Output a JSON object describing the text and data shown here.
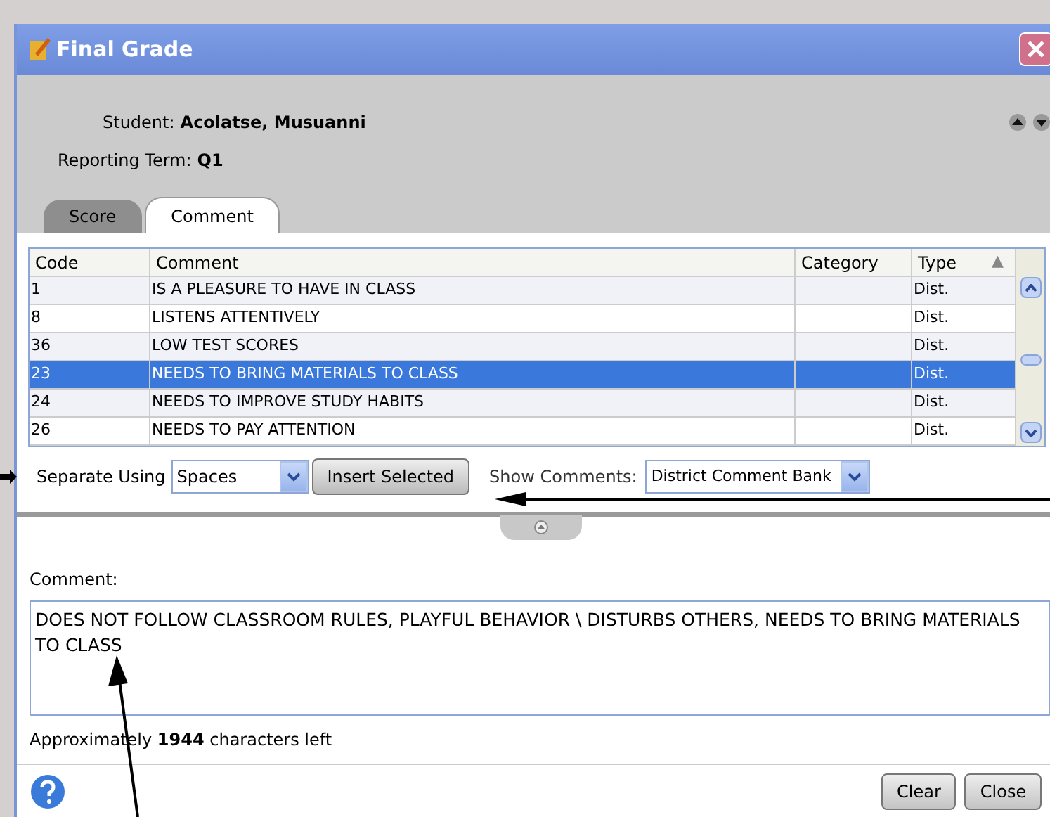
{
  "window": {
    "title": "Final Grade"
  },
  "student": {
    "label": "Student:",
    "value": "Acolatse, Musuanni"
  },
  "term": {
    "label": "Reporting Term:",
    "value": "Q1"
  },
  "tabs": [
    {
      "label": "Score",
      "selected": false
    },
    {
      "label": "Comment",
      "selected": true
    }
  ],
  "table": {
    "columns": [
      "Code",
      "Comment",
      "Category",
      "Type"
    ],
    "sort_mark": "▲",
    "rows": [
      {
        "code": "1",
        "comment": "IS A PLEASURE TO HAVE IN CLASS",
        "category": "",
        "type": "Dist.",
        "selected": false
      },
      {
        "code": "8",
        "comment": "LISTENS ATTENTIVELY",
        "category": "",
        "type": "Dist.",
        "selected": false
      },
      {
        "code": "36",
        "comment": "LOW TEST SCORES",
        "category": "",
        "type": "Dist.",
        "selected": false
      },
      {
        "code": "23",
        "comment": "NEEDS TO BRING MATERIALS TO CLASS",
        "category": "",
        "type": "Dist.",
        "selected": true
      },
      {
        "code": "24",
        "comment": "NEEDS TO IMPROVE STUDY HABITS",
        "category": "",
        "type": "Dist.",
        "selected": false
      },
      {
        "code": "26",
        "comment": "NEEDS TO PAY ATTENTION",
        "category": "",
        "type": "Dist.",
        "selected": false
      }
    ]
  },
  "separate": {
    "label": "Separate Using",
    "value": "Spaces"
  },
  "insert_button": "Insert Selected",
  "show_comments": {
    "label": "Show Comments:",
    "value": "District Comment Bank"
  },
  "comment": {
    "label": "Comment:",
    "value": "DOES NOT FOLLOW CLASSROOM RULES,  PLAYFUL BEHAVIOR \\ DISTURBS OTHERS,  NEEDS TO BRING MATERIALS TO CLASS"
  },
  "chars_left": "Approximately **1944** characters left",
  "buttons": [
    "Clear",
    "Close"
  ]
}
